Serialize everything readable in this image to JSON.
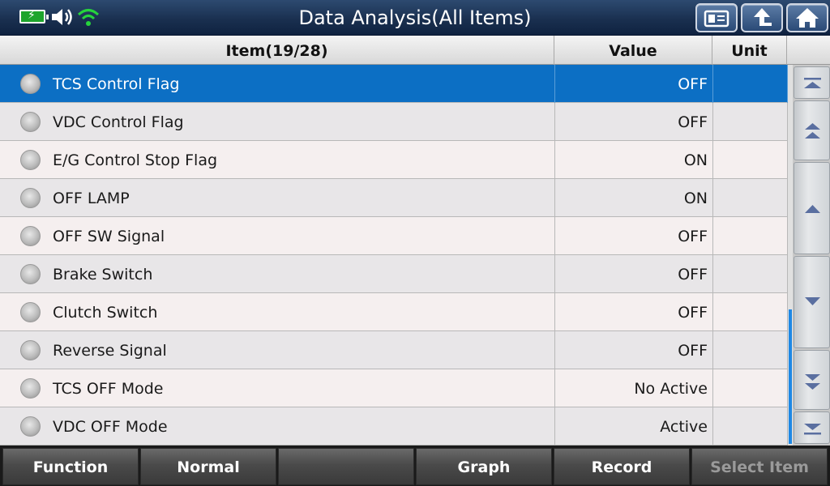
{
  "header": {
    "title": "Data Analysis(All Items)",
    "battery_symbol": "⚡",
    "status_icons": [
      "battery-icon",
      "speaker-icon",
      "wifi-icon"
    ],
    "buttons": [
      "id-card-icon",
      "back-icon",
      "home-icon"
    ]
  },
  "table": {
    "columns": [
      "Item(19/28)",
      "Value",
      "Unit"
    ],
    "rows": [
      {
        "name": "TCS Control Flag",
        "value": "OFF",
        "unit": ""
      },
      {
        "name": "VDC Control Flag",
        "value": "OFF",
        "unit": ""
      },
      {
        "name": "E/G Control Stop Flag",
        "value": "ON",
        "unit": ""
      },
      {
        "name": "OFF LAMP",
        "value": "ON",
        "unit": ""
      },
      {
        "name": "OFF SW Signal",
        "value": "OFF",
        "unit": ""
      },
      {
        "name": "Brake Switch",
        "value": "OFF",
        "unit": ""
      },
      {
        "name": "Clutch Switch",
        "value": "OFF",
        "unit": ""
      },
      {
        "name": "Reverse Signal",
        "value": "OFF",
        "unit": ""
      },
      {
        "name": "TCS OFF Mode",
        "value": "No Active",
        "unit": ""
      },
      {
        "name": "VDC OFF Mode",
        "value": "Active",
        "unit": ""
      }
    ],
    "selected_index": 0
  },
  "scroll_buttons": [
    "scroll-top-icon",
    "page-up-icon",
    "line-up-icon",
    "line-down-icon",
    "page-down-icon",
    "scroll-bottom-icon"
  ],
  "colors": {
    "selected_row": "#0c6fc4",
    "title_bar": "#1a3050",
    "scrollbar_thumb": "#1e88e5"
  },
  "bottom_bar": {
    "function": "Function",
    "normal": "Normal",
    "blank": "",
    "graph": "Graph",
    "record": "Record",
    "select_item": "Select Item"
  }
}
